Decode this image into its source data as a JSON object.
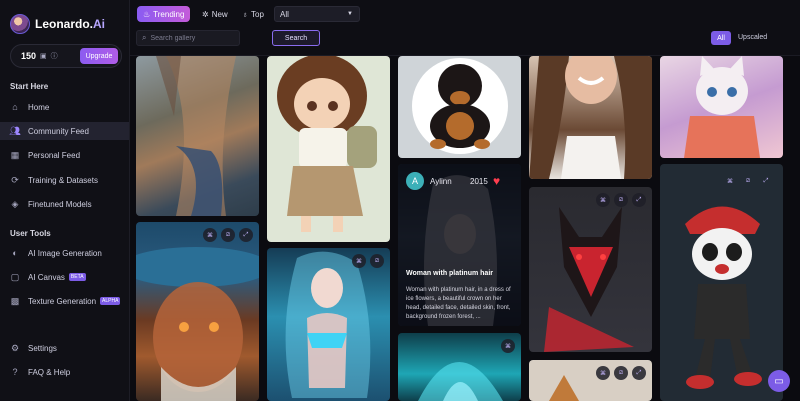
{
  "app": {
    "name_main": "Leonardo.",
    "name_ai": "Ai"
  },
  "credits": {
    "count": "150",
    "upgrade_label": "Upgrade"
  },
  "sidebar": {
    "start_here_title": "Start Here",
    "start_items": [
      {
        "label": "Home",
        "icon": "home-icon"
      },
      {
        "label": "Community Feed",
        "icon": "people-icon"
      },
      {
        "label": "Personal Feed",
        "icon": "grid-icon"
      },
      {
        "label": "Training & Datasets",
        "icon": "training-icon"
      },
      {
        "label": "Finetuned Models",
        "icon": "cube-icon"
      }
    ],
    "user_tools_title": "User Tools",
    "tool_items": [
      {
        "label": "AI Image Generation",
        "icon": "palette-icon"
      },
      {
        "label": "AI Canvas",
        "icon": "canvas-icon",
        "badge": "BETA"
      },
      {
        "label": "Texture Generation",
        "icon": "texture-icon",
        "badge": "ALPHA"
      }
    ],
    "bottom_items": [
      {
        "label": "Settings",
        "icon": "gear-icon"
      },
      {
        "label": "FAQ & Help",
        "icon": "help-icon"
      }
    ]
  },
  "topbar": {
    "tabs": [
      {
        "label": "Trending",
        "icon": "flame-icon"
      },
      {
        "label": "New",
        "icon": "sparkle-icon"
      },
      {
        "label": "Top",
        "icon": "fire-icon"
      }
    ],
    "filter_value": "All",
    "search_placeholder": "Search gallery",
    "search_button": "Search",
    "scope_all": "All",
    "scope_upscaled": "Upscaled"
  },
  "featured_card": {
    "avatar_letter": "A",
    "username": "Aylinn",
    "likes": "2015",
    "title": "Woman with platinum hair",
    "description": "Woman with platinum hair, in a dress of ice flowers, a beautiful crown on her head, detailed face, detailed skin, front, background frozen forest, ..."
  },
  "colors": {
    "accent": "#7c5ce6",
    "accent_gradient_end": "#c45bd9",
    "heart": "#ff3e4f",
    "background": "#0b0b10"
  }
}
